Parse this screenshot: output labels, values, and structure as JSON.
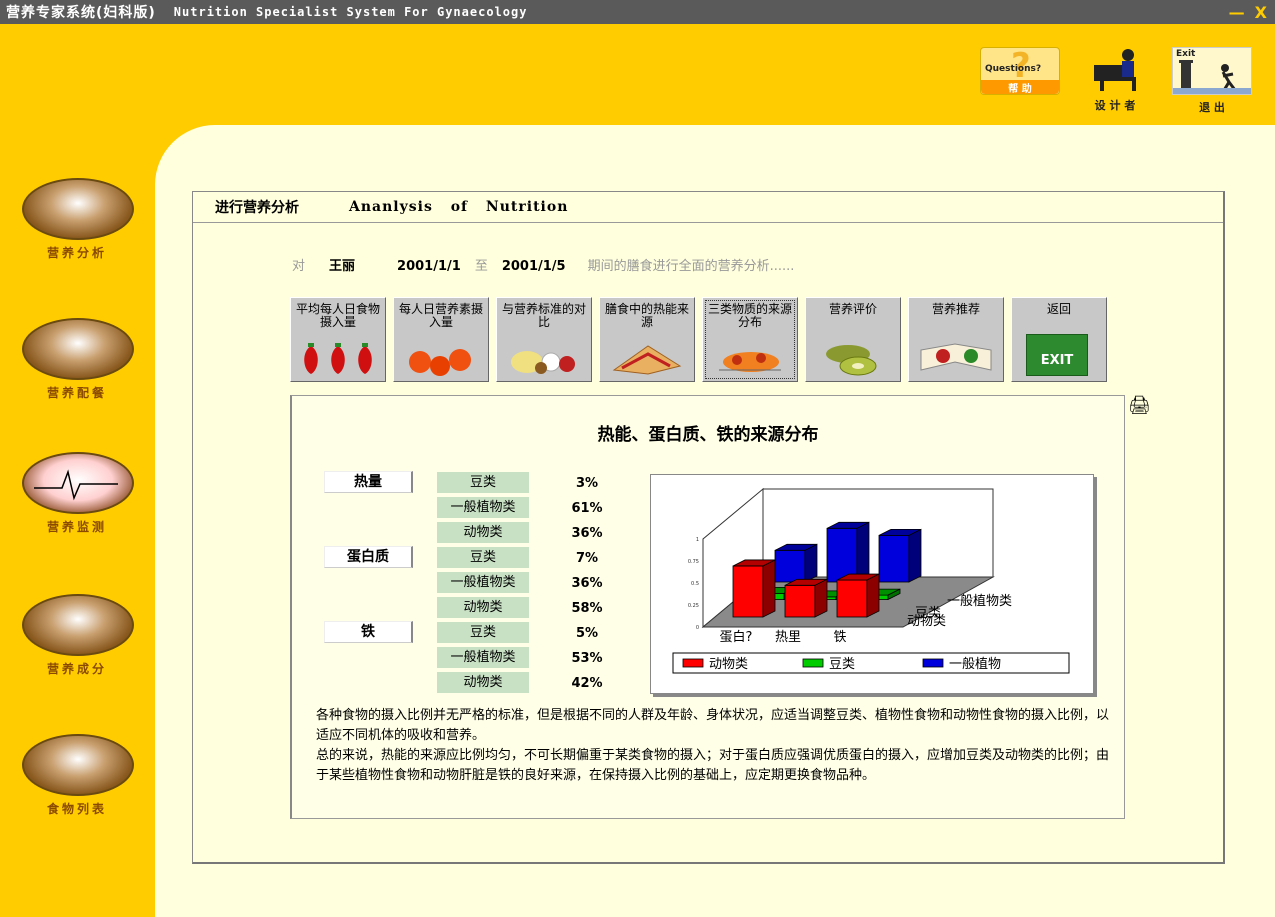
{
  "window": {
    "title_cn": "营养专家系统(妇科版)",
    "title_en": "Nutrition  Specialist  System  For  Gynaecology",
    "minimize": "—",
    "close": "X"
  },
  "top_icons": {
    "help": {
      "badge": "Questions?",
      "label": "帮  助"
    },
    "designer": {
      "label": "设 计 者"
    },
    "exit": {
      "badge": "Exit",
      "label": "退  出"
    }
  },
  "sidebar": {
    "items": [
      {
        "label": "营养分析",
        "icon": "microscope-doctor-icon"
      },
      {
        "label": "营养配餐",
        "icon": "meal-plate-icon"
      },
      {
        "label": "营养监测",
        "icon": "heartbeat-monitor-icon"
      },
      {
        "label": "营养成分",
        "icon": "food-box-icon"
      },
      {
        "label": "食物列表",
        "icon": "food-basket-icon"
      }
    ]
  },
  "panel": {
    "title_cn": "进行营养分析",
    "title_en": "Ananlysis  of  Nutrition"
  },
  "info": {
    "prefix": "对",
    "name": "王丽",
    "start_date": "2001/1/1",
    "to": "至",
    "end_date": "2001/1/5",
    "suffix": "期间的膳食进行全面的营养分析......"
  },
  "buttons": [
    {
      "label": "平均每人日食物摄入量"
    },
    {
      "label": "每人日营养素摄入量"
    },
    {
      "label": "与营养标准的对比"
    },
    {
      "label": "膳食中的热能来源"
    },
    {
      "label": "三类物质的来源分布",
      "active": true
    },
    {
      "label": "营养评价"
    },
    {
      "label": "营养推荐"
    },
    {
      "label": "返回",
      "badge": "EXIT"
    }
  ],
  "content": {
    "title": "热能、蛋白质、铁的来源分布",
    "groups": [
      {
        "nutrient": "热量",
        "sources": [
          {
            "name": "豆类",
            "pct": "3%"
          },
          {
            "name": "一般植物类",
            "pct": "61%"
          },
          {
            "name": "动物类",
            "pct": "36%"
          }
        ]
      },
      {
        "nutrient": "蛋白质",
        "sources": [
          {
            "name": "豆类",
            "pct": "7%"
          },
          {
            "name": "一般植物类",
            "pct": "36%"
          },
          {
            "name": "动物类",
            "pct": "58%"
          }
        ]
      },
      {
        "nutrient": "铁",
        "sources": [
          {
            "name": "豆类",
            "pct": "5%"
          },
          {
            "name": "一般植物类",
            "pct": "53%"
          },
          {
            "name": "动物类",
            "pct": "42%"
          }
        ]
      }
    ],
    "description": [
      "各种食物的摄入比例并无严格的标准，但是根据不同的人群及年龄、身体状况，应适当调整豆类、植物性食物和动物性食物的摄入比例，以适应不同机体的吸收和营养。",
      "总的来说，热能的来源应比例均匀，不可长期偏重于某类食物的摄入；对于蛋白质应强调优质蛋白的摄入，应增加豆类及动物类的比例；由于某些植物性食物和动物肝脏是铁的良好来源，在保持摄入比例的基础上，应定期更换食物品种。"
    ]
  },
  "chart_data": {
    "type": "bar",
    "categories": [
      "蛋白?",
      "热里",
      "铁"
    ],
    "series": [
      {
        "name": "动物类",
        "color": "#ff0000",
        "values": [
          0.58,
          0.36,
          0.42
        ]
      },
      {
        "name": "豆类",
        "color": "#00cc00",
        "values": [
          0.07,
          0.03,
          0.05
        ]
      },
      {
        "name": "一般植物",
        "color": "#0000dd",
        "values": [
          0.36,
          0.61,
          0.53
        ]
      }
    ],
    "depth_labels": [
      "豆类",
      "一般植物类",
      "动物类"
    ],
    "yticks": [
      "1",
      "0.75",
      "0.5",
      "0.25",
      "0"
    ],
    "ylim": [
      0,
      1
    ],
    "legend": "bottom"
  }
}
